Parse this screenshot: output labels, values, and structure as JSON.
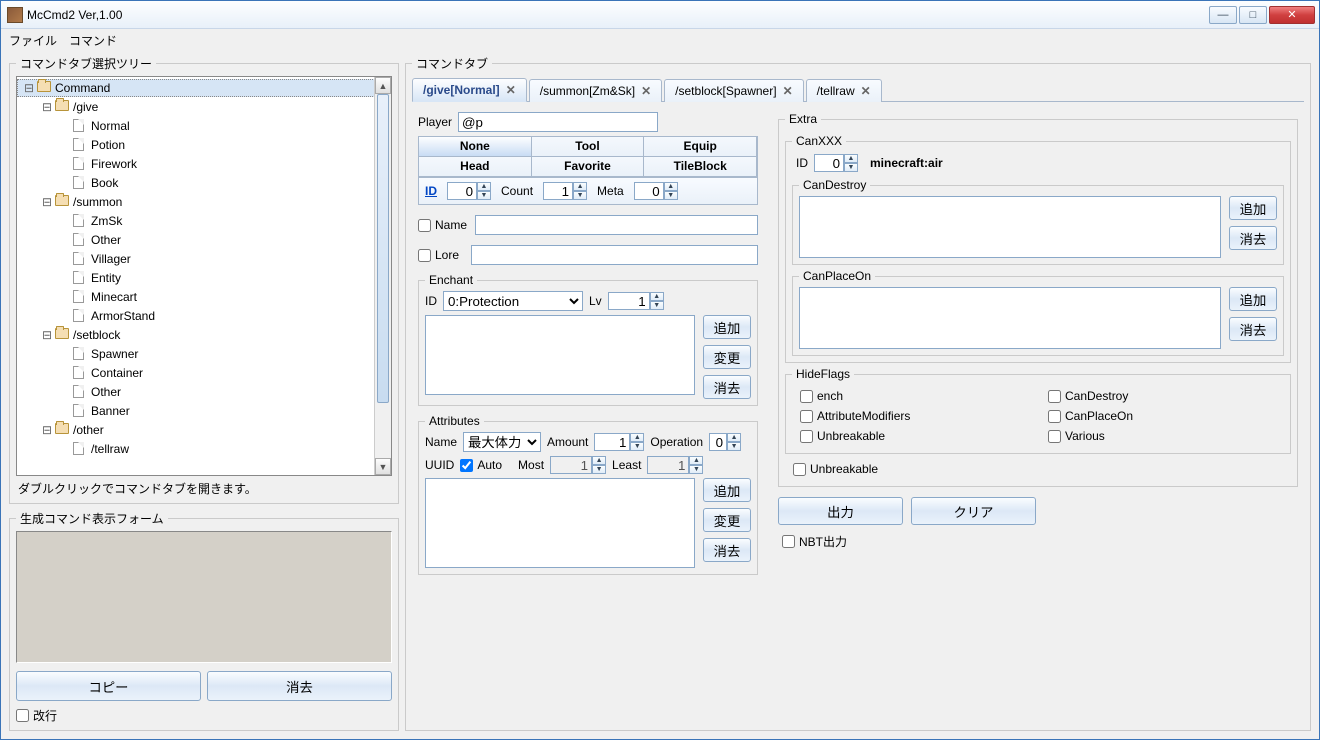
{
  "title": "McCmd2 Ver,1.00",
  "menu": {
    "file": "ファイル",
    "command": "コマンド"
  },
  "left": {
    "tree_legend": "コマンドタブ選択ツリー",
    "hint": "ダブルクリックでコマンドタブを開きます。",
    "root": "Command",
    "groups": [
      {
        "name": "/give",
        "items": [
          "Normal",
          "Potion",
          "Firework",
          "Book"
        ]
      },
      {
        "name": "/summon",
        "items": [
          "ZmSk",
          "Other",
          "Villager",
          "Entity",
          "Minecart",
          "ArmorStand"
        ]
      },
      {
        "name": "/setblock",
        "items": [
          "Spawner",
          "Container",
          "Other",
          "Banner"
        ]
      },
      {
        "name": "/other",
        "items": [
          "/tellraw"
        ]
      }
    ],
    "gen_legend": "生成コマンド表示フォーム",
    "copy": "コピー",
    "clear": "消去",
    "linebreak": "改行"
  },
  "main": {
    "legend": "コマンドタブ",
    "tabs": [
      "/give[Normal]",
      "/summon[Zm&Sk]",
      "/setblock[Spawner]",
      "/tellraw"
    ],
    "active_tab": 0,
    "player_label": "Player",
    "player_value": "@p",
    "subtabs_row1": [
      "None",
      "Tool",
      "Equip"
    ],
    "subtabs_row2": [
      "Head",
      "Favorite",
      "TileBlock"
    ],
    "active_subtab": "None",
    "id_label": "ID",
    "id_val": "0",
    "count_label": "Count",
    "count_val": "1",
    "meta_label": "Meta",
    "meta_val": "0",
    "name_chk": "Name",
    "lore_chk": "Lore",
    "enchant": {
      "legend": "Enchant",
      "id_label": "ID",
      "id_value": "0:Protection",
      "lv_label": "Lv",
      "lv_value": "1",
      "add": "追加",
      "change": "変更",
      "clear": "消去"
    },
    "attr": {
      "legend": "Attributes",
      "name_label": "Name",
      "name_value": "最大体力",
      "amount_label": "Amount",
      "amount_value": "1",
      "op_label": "Operation",
      "op_value": "0",
      "uuid_label": "UUID",
      "auto_label": "Auto",
      "most_label": "Most",
      "most_value": "1",
      "least_label": "Least",
      "least_value": "1",
      "add": "追加",
      "change": "変更",
      "clear": "消去"
    }
  },
  "extra": {
    "legend": "Extra",
    "canxxx": {
      "legend": "CanXXX",
      "id_label": "ID",
      "id_val": "0",
      "item_name": "minecraft:air",
      "destroy_legend": "CanDestroy",
      "place_legend": "CanPlaceOn",
      "add": "追加",
      "clear": "消去"
    },
    "hideflags": {
      "legend": "HideFlags",
      "items": [
        "ench",
        "CanDestroy",
        "AttributeModifiers",
        "CanPlaceOn",
        "Unbreakable",
        "Various"
      ]
    },
    "unbreakable": "Unbreakable",
    "output_btn": "出力",
    "clear_btn": "クリア",
    "nbt_out": "NBT出力"
  }
}
